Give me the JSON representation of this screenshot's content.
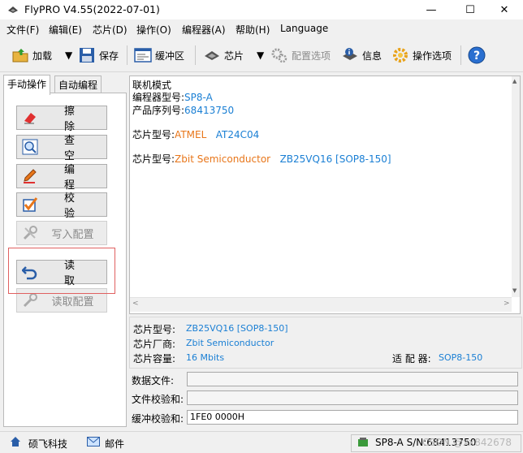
{
  "window": {
    "title": "FlyPRO V4.55(2022-07-01)",
    "minimize": "—",
    "maximize": "☐",
    "close": "✕"
  },
  "menu": [
    "文件(F)",
    "编辑(E)",
    "芯片(D)",
    "操作(O)",
    "编程器(A)",
    "帮助(H)",
    "Language"
  ],
  "toolbar": {
    "load": "加载",
    "save": "保存",
    "buffer": "缓冲区",
    "chip": "芯片",
    "config_options": "配置选项",
    "info": "信息",
    "op_options": "操作选项"
  },
  "tabs": {
    "manual": "手动操作",
    "auto": "自动编程"
  },
  "actions": {
    "erase": "擦除",
    "blank_check": "查空",
    "program": "编程",
    "verify": "校验",
    "write_config": "写入配置",
    "read": "读取",
    "read_config": "读取配置"
  },
  "info": {
    "mode": "联机模式",
    "programmer_model_label": "编程器型号:",
    "programmer_model": "SP8-A",
    "serial_label": "产品序列号:",
    "serial": "68413750",
    "chip1_label": "芯片型号:",
    "chip1_vendor": "ATMEL",
    "chip1_model": "AT24C04",
    "chip2_label": "芯片型号:",
    "chip2_vendor": "Zbit Semiconductor",
    "chip2_model": "ZB25VQ16 [SOP8-150]"
  },
  "details": {
    "chip_model_label": "芯片型号:",
    "chip_model": "ZB25VQ16 [SOP8-150]",
    "vendor_label": "芯片厂商:",
    "vendor": "Zbit Semiconductor",
    "capacity_label": "芯片容量:",
    "capacity": "16 Mbits",
    "adapter_label": "适 配 器:",
    "adapter": "SOP8-150"
  },
  "fields": {
    "data_file_label": "数据文件:",
    "data_file": "",
    "file_checksum_label": "文件校验和:",
    "file_checksum": "",
    "buffer_checksum_label": "缓冲校验和:",
    "buffer_checksum": "1FE0 0000H"
  },
  "statusbar": {
    "company": "硕飞科技",
    "mail": "邮件",
    "device": "SP8-A  S/N:68413750",
    "watermark": "CSDN @xx842678"
  }
}
